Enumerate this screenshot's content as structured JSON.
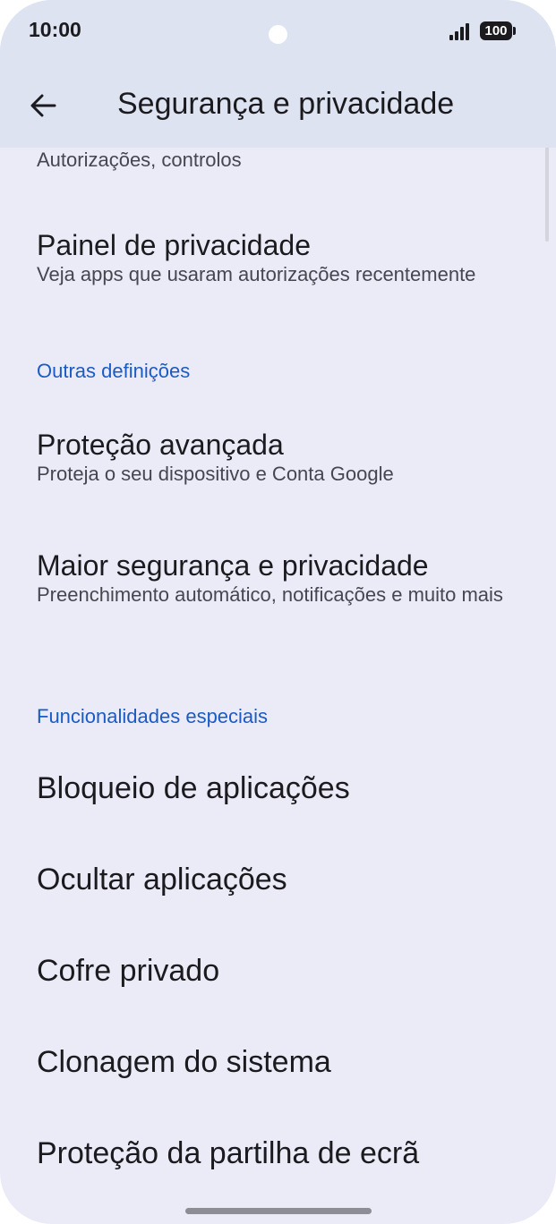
{
  "status_bar": {
    "time": "10:00",
    "battery": "100"
  },
  "app_bar": {
    "title": "Segurança e privacidade",
    "back_icon": "arrow-back-icon"
  },
  "items": {
    "top_partial": {
      "subtitle": "Autorizações, controlos"
    },
    "privacy_dashboard": {
      "title": "Painel de privacidade",
      "subtitle": "Veja apps que usaram autorizações recentemente"
    },
    "advanced_protection": {
      "title": "Proteção avançada",
      "subtitle": "Proteja o seu dispositivo e Conta Google"
    },
    "more_security": {
      "title": "Maior segurança e privacidade",
      "subtitle": "Preenchimento automático, notificações e muito mais"
    },
    "app_lock": {
      "title": "Bloqueio de aplicações"
    },
    "hide_apps": {
      "title": "Ocultar aplicações"
    },
    "private_safe": {
      "title": "Cofre privado"
    },
    "system_clone": {
      "title": "Clonagem do sistema"
    },
    "screen_share_protection": {
      "title": "Proteção da partilha de ecrã"
    }
  },
  "sections": {
    "other_settings": "Outras definições",
    "special_features": "Funcionalidades especiais"
  },
  "colors": {
    "background": "#ebebf8",
    "app_bar": "#dee3f1",
    "section_header": "#1a5bc4",
    "text_primary": "#1b1b1f",
    "text_secondary": "#45464f"
  }
}
